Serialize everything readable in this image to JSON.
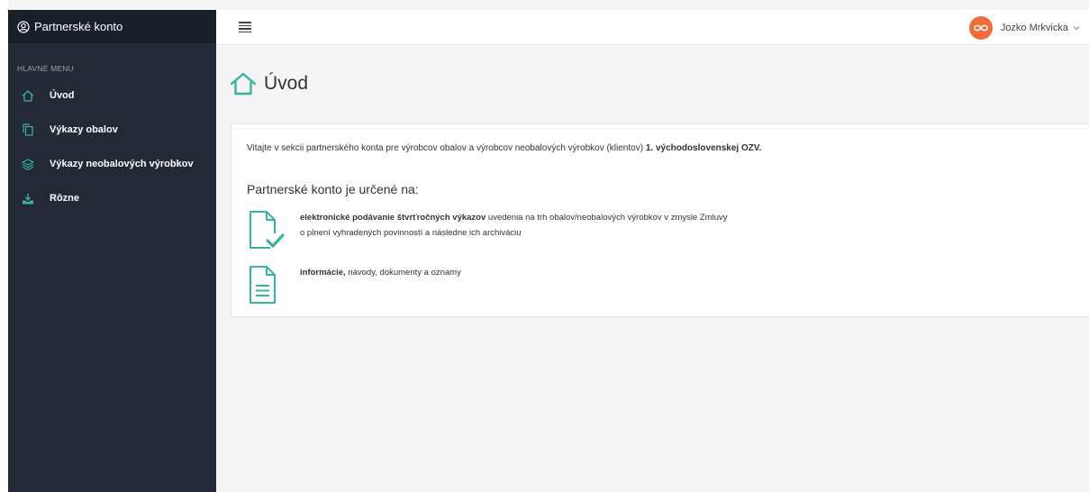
{
  "sidebar": {
    "brand": "Partnerské konto",
    "menu_title": "HLAVNÉ MENU",
    "items": [
      {
        "label": "Úvod",
        "icon": "home-icon"
      },
      {
        "label": "Výkazy obalov",
        "icon": "documents-icon"
      },
      {
        "label": "Výkazy neobalových výrobkov",
        "icon": "layers-icon"
      },
      {
        "label": "Rôzne",
        "icon": "download-tray-icon"
      }
    ]
  },
  "topbar": {
    "menu_icon": "hamburger-icon",
    "user_name": "Jozko Mrkvicka",
    "avatar_icon": "infinity-icon"
  },
  "page": {
    "title": "Úvod"
  },
  "content": {
    "intro_text": "Vitajte v sekcii partnerského konta pre výrobcov obalov a výrobcov neobalových výrobkov (klientov)",
    "intro_bold": "1. východoslovenskej OZV.",
    "subheading": "Partnerské konto je určené na:",
    "features": [
      {
        "bold": "elektronické podávanie štvrťročných výkazov",
        "text": "uvedenia na trh obalov/neobalových výrobkov v zmysle Zmluvy",
        "text2": "o plnení vyhradených povinností a následne ich archiváciu",
        "icon": "document-check-icon"
      },
      {
        "bold": "informácie,",
        "text": "návody, dokumenty a oznamy",
        "icon": "document-lines-icon"
      }
    ]
  },
  "colors": {
    "accent": "#36b49c",
    "sidebar_bg": "#232a35",
    "avatar_bg": "#f26b3a"
  }
}
